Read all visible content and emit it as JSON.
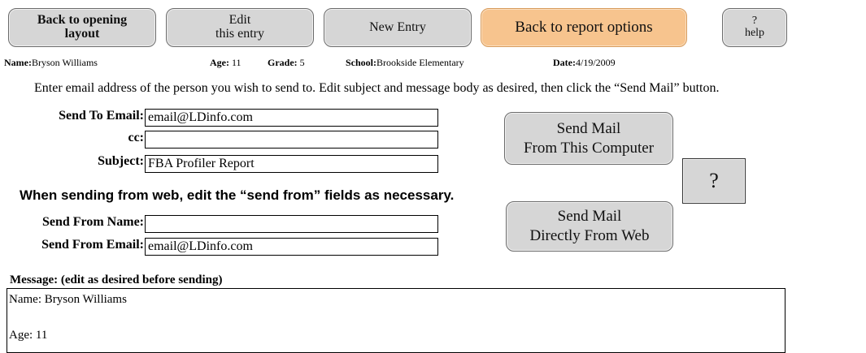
{
  "toolbar": {
    "back_opening_line1": "Back to opening",
    "back_opening_line2": "layout",
    "edit_line1": "Edit",
    "edit_line2": "this entry",
    "new_entry": "New Entry",
    "back_report": "Back to report options",
    "help_line1": "?",
    "help_line2": "help"
  },
  "student": {
    "name_label": "Name:",
    "name": "Bryson Williams",
    "age_label": "Age:",
    "age": "11",
    "grade_label": "Grade:",
    "grade": "5",
    "school_label": "School:",
    "school": "Brookside Elementary",
    "date_label": "Date:",
    "date": "4/19/2009"
  },
  "instructions": "Enter email address of the person you wish to send to.  Edit subject and message body as desired, then click the “Send Mail” button.",
  "form": {
    "send_to_label": "Send To Email:",
    "send_to_value": "email@LDinfo.com",
    "cc_label": "cc:",
    "cc_value": "",
    "subject_label": "Subject:",
    "subject_value": "FBA Profiler Report",
    "web_note": "When sending from web, edit the “send from” fields as necessary.",
    "from_name_label": "Send From Name:",
    "from_name_value": "",
    "from_email_label": "Send From Email:",
    "from_email_value": "email@LDinfo.com"
  },
  "actions": {
    "send_computer_line1": "Send Mail",
    "send_computer_line2": "From This Computer",
    "question": "?",
    "send_web_line1": "Send Mail",
    "send_web_line2": "Directly From Web"
  },
  "message": {
    "label": "Message:  (edit as desired before sending)",
    "lines": [
      "Name: Bryson Williams",
      "",
      "Age: 11"
    ]
  }
}
